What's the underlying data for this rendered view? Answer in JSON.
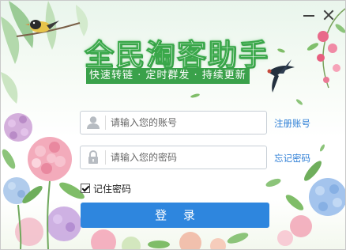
{
  "window": {
    "controls": [
      "minimize-icon",
      "close-icon"
    ]
  },
  "header": {
    "title": "全民淘客助手",
    "slogan": "快速转链 · 定时群发 · 持续更新"
  },
  "login_form": {
    "username_placeholder": "请输入您的账号",
    "password_placeholder": "请输入您的密码",
    "register_label": "注册账号",
    "forgot_label": "忘记密码",
    "remember_label": "记住密码",
    "remember_checked": true,
    "submit_label": "登 录",
    "icons": [
      "user-icon",
      "lock-icon"
    ]
  },
  "colors": {
    "accent": "#2e86de",
    "link": "#2f7fd6",
    "title_green": "#3aa84a",
    "slogan_bg": "#3aa14a"
  }
}
